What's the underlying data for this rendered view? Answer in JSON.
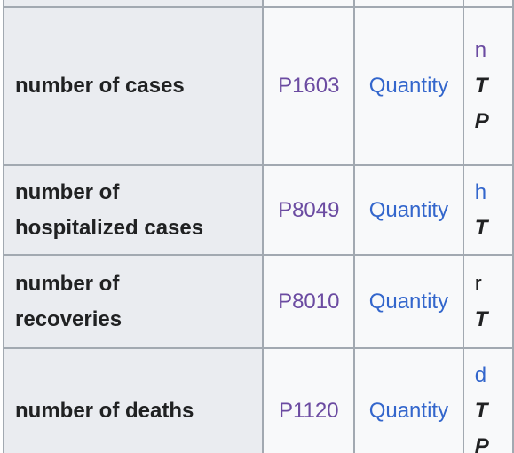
{
  "table": {
    "rows": [
      {
        "label": "number of cases",
        "property_id": "P1603",
        "datatype": "Quantity",
        "description_lines": [
          {
            "text": "n",
            "style": "link"
          },
          {
            "text": "T",
            "style": "italic"
          },
          {
            "text": "P",
            "style": "italic"
          }
        ]
      },
      {
        "label_line1": "number of",
        "label_line2": "hospitalized cases",
        "property_id": "P8049",
        "datatype": "Quantity",
        "description_lines": [
          {
            "text": "h",
            "style": "link"
          },
          {
            "text": "T",
            "style": "italic"
          }
        ]
      },
      {
        "label_line1": "number of",
        "label_line2": "recoveries",
        "property_id": "P8010",
        "datatype": "Quantity",
        "description_lines": [
          {
            "text": "r",
            "style": "plain"
          },
          {
            "text": "T",
            "style": "italic"
          }
        ]
      },
      {
        "label": "number of deaths",
        "property_id": "P1120",
        "datatype": "Quantity",
        "description_lines": [
          {
            "text": "d",
            "style": "link"
          },
          {
            "text": "T",
            "style": "italic"
          },
          {
            "text": "P",
            "style": "italic"
          }
        ]
      }
    ]
  },
  "colors": {
    "border": "#a2a9b1",
    "label_background": "#eaecf0",
    "cell_background": "#f8f9fa",
    "visited_link": "#6b4ba1",
    "link": "#3366cc",
    "text": "#202122"
  }
}
